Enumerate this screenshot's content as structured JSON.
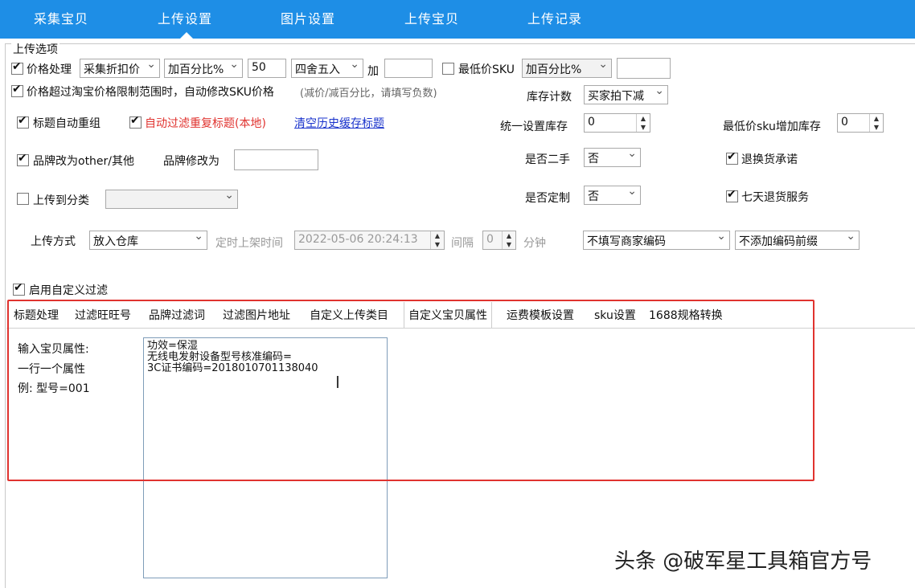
{
  "nav": {
    "tabs": [
      "采集宝贝",
      "上传设置",
      "图片设置",
      "上传宝贝",
      "上传记录"
    ],
    "active_index": 1
  },
  "group_title": "上传选项",
  "price": {
    "label": "价格处理",
    "mode": "采集折扣价",
    "method": "加百分比%",
    "value": "50",
    "rounding": "四舍五入",
    "add_label": "加",
    "add_value": "",
    "min_sku_label": "最低价SKU",
    "min_sku_method": "加百分比%",
    "min_sku_value": ""
  },
  "over_limit_label": "价格超过淘宝价格限制范围时，自动修改SKU价格",
  "over_limit_hint": "(减价/减百分比，请填写负数)",
  "stock_count": {
    "label": "库存计数",
    "value": "买家拍下减"
  },
  "title_regroup_label": "标题自动重组",
  "dedupe_title_label": "自动过滤重复标题(本地)",
  "clear_cache_link": "清空历史缓存标题",
  "unified_stock": {
    "label": "统一设置库存",
    "value": "0"
  },
  "min_sku_stock": {
    "label": "最低价sku增加库存",
    "value": "0"
  },
  "brand_other_label": "品牌改为other/其他",
  "brand_change_label": "品牌修改为",
  "brand_change_value": "",
  "second_hand": {
    "label": "是否二手",
    "value": "否"
  },
  "return_promise_label": "退换货承诺",
  "upload_category_label": "上传到分类",
  "upload_category_value": "",
  "custom_made": {
    "label": "是否定制",
    "value": "否"
  },
  "seven_day_label": "七天退货服务",
  "upload_method": {
    "label": "上传方式",
    "value": "放入仓库",
    "timer_label": "定时上架时间",
    "timer_value": "2022-05-06 20:24:13",
    "interval_label": "间隔",
    "interval_value": "0",
    "minute_label": "分钟",
    "merchant_code": "不填写商家编码",
    "code_prefix": "不添加编码前缀"
  },
  "custom_filter_label": "启用自定义过滤",
  "sub_tabs": [
    "标题处理",
    "过滤旺旺号",
    "品牌过滤词",
    "过滤图片地址",
    "自定义上传类目",
    "自定义宝贝属性",
    "运费模板设置",
    "sku设置",
    "1688规格转换"
  ],
  "sub_active_index": 5,
  "attr_help": {
    "line1": "输入宝贝属性:",
    "line2": "一行一个属性",
    "line3": "例: 型号=001"
  },
  "attr_text": "功效=保湿\n无线电发射设备型号核准编码=\n3C证书编码=2018010701138040",
  "watermark": "头条 @破军星工具箱官方号",
  "colors": {
    "nav_bg": "#1e8ee6",
    "highlight": "#e0332f",
    "link": "#1a33cc"
  }
}
